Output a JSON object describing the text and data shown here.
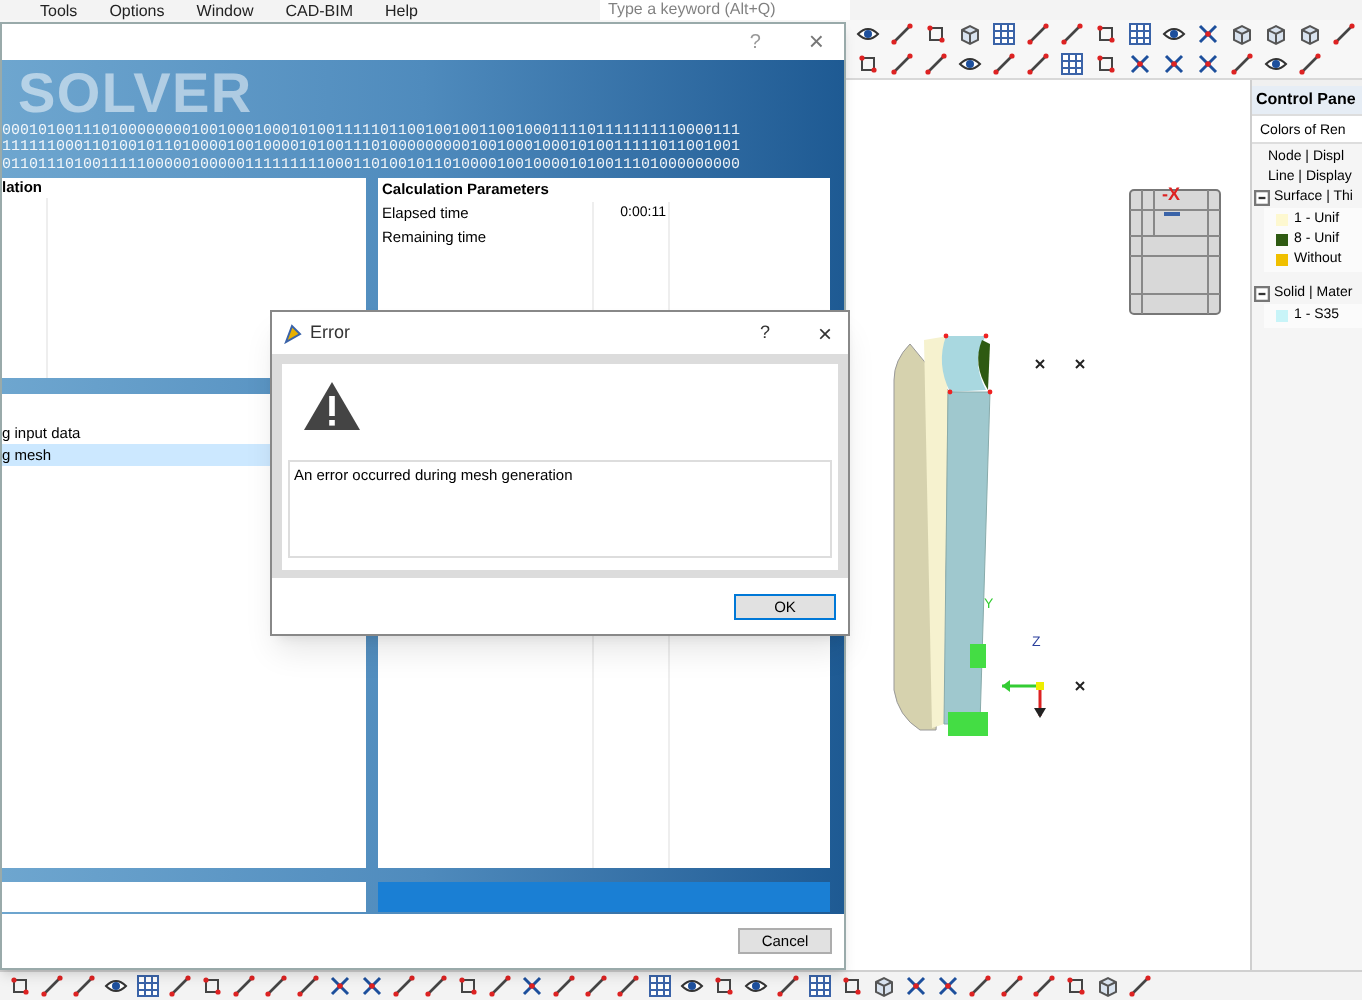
{
  "app": {
    "menu": [
      "Tools",
      "Options",
      "Window",
      "CAD-BIM",
      "Help"
    ],
    "search": {
      "placeholder": "Type a keyword (Alt+Q)"
    }
  },
  "viewport": {
    "nav_cube_label": "-X",
    "axis_labels": [
      "Y",
      "Z"
    ]
  },
  "control_panel": {
    "title": "Control Pane",
    "subtitle": "Colors of Ren",
    "items": [
      {
        "kind": "row",
        "label": "Node | Displ"
      },
      {
        "kind": "row",
        "label": "Line | Display"
      },
      {
        "kind": "group",
        "label": "Surface | Thi",
        "expanded": true,
        "children": [
          {
            "label": "1 - Unif",
            "color": "#fdf8d0"
          },
          {
            "label": "8 - Unif",
            "color": "#2e5a12"
          },
          {
            "label": "Without",
            "color": "#f0c000"
          }
        ]
      },
      {
        "kind": "group",
        "label": "Solid | Mater",
        "expanded": true,
        "children": [
          {
            "label": "1 - S35",
            "color": "#c8f4f8"
          }
        ]
      }
    ]
  },
  "solver_dialog": {
    "help": "?",
    "close": "×",
    "banner_title": "SOLVER",
    "binary_lines": [
      "0001010011101000000001001000100010100111110110010010011001000111101111111110000111",
      "1111110001101001011010000100100001010011101000000000100100010001010011111011001001",
      "0110111010011111000001000001111111110001101001011010000100100001010011101000000000"
    ],
    "left_panel": {
      "title": "lation"
    },
    "parameters": {
      "title": "Calculation Parameters",
      "rows": [
        {
          "label": "Elapsed time",
          "value": "0:00:11"
        },
        {
          "label": "Remaining time"
        }
      ]
    },
    "steps": [
      {
        "label": "g input data",
        "selected": false
      },
      {
        "label": "g mesh",
        "selected": true
      }
    ],
    "progress": {
      "level": 1
    },
    "cancel": "Cancel"
  },
  "error_dialog": {
    "title": "Error",
    "help": "?",
    "close": "×",
    "message": "An error occurred during mesh generation",
    "ok": "OK"
  }
}
